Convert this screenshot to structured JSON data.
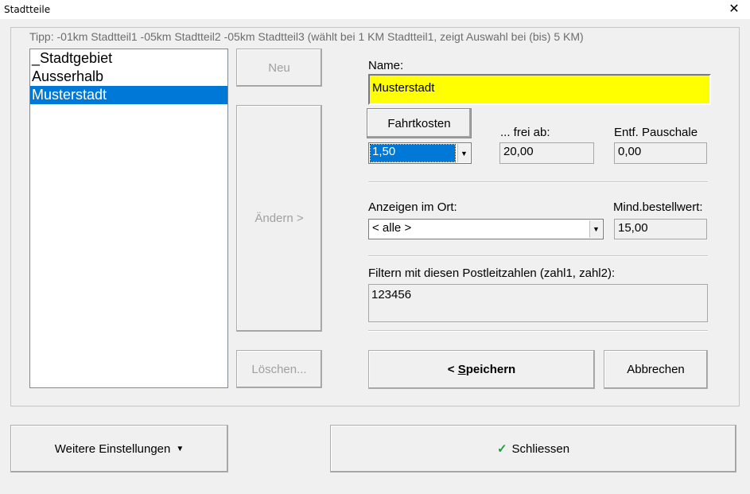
{
  "window": {
    "title": "Stadtteile",
    "close_glyph": "✕"
  },
  "tip": "Tipp: -01km Stadtteil1   -05km Stadtteil2   -05km Stadtteil3  (wählt bei 1 KM Stadtteil1, zeigt Auswahl bei (bis) 5 KM)",
  "list": {
    "items": [
      "_Stadtgebiet",
      "Ausserhalb",
      "Musterstadt"
    ],
    "selected_index": 2
  },
  "buttons": {
    "neu": "Neu",
    "aendern": "Ändern >",
    "loeschen": "Löschen...",
    "fahrtkosten": "Fahrtkosten",
    "speichern_prefix": "< ",
    "speichern_hotkey": "S",
    "speichern_rest": "peichern",
    "abbrechen": "Abbrechen",
    "weitere": "Weitere Einstellungen",
    "schliessen": "Schliessen"
  },
  "form": {
    "name_label": "Name:",
    "name_value": "Musterstadt",
    "fahrtkosten_value": "1,50",
    "frei_ab_label": "... frei ab:",
    "frei_ab_value": "20,00",
    "pauschale_label": "Entf. Pauschale",
    "pauschale_value": "0,00",
    "anzeigen_label": "Anzeigen im Ort:",
    "anzeigen_value": "< alle >",
    "mindest_label": "Mind.bestellwert:",
    "mindest_value": "15,00",
    "plz_label": "Filtern mit diesen Postleitzahlen (zahl1, zahl2):",
    "plz_value": "123456"
  },
  "colors": {
    "selection": "#0078d7",
    "name_field_bg": "#ffff00",
    "check": "#1f9e3b"
  }
}
